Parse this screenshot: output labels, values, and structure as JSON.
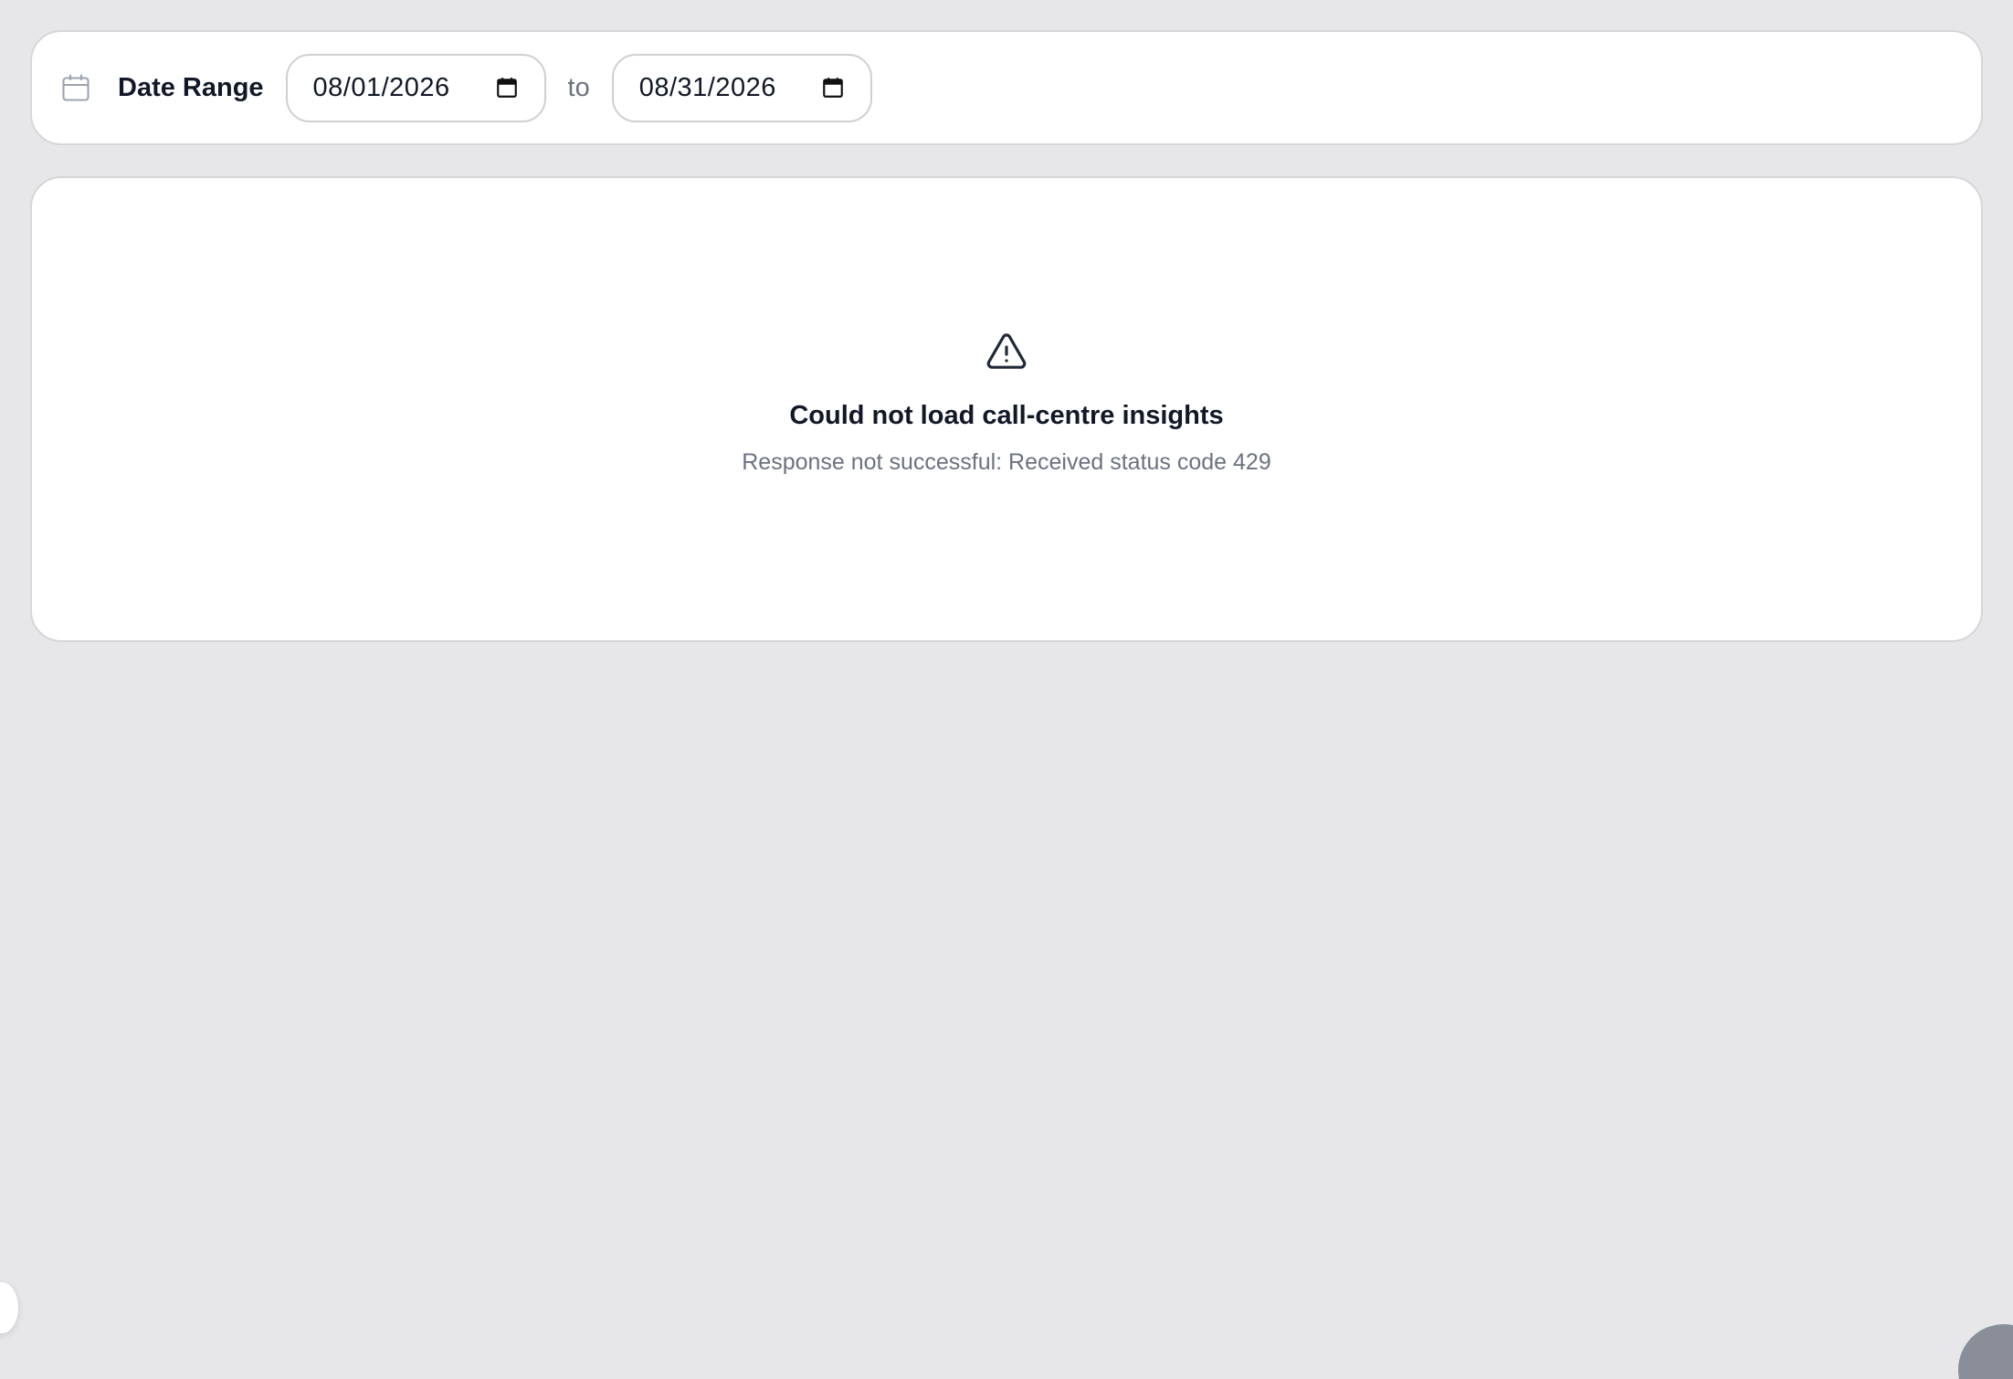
{
  "filter": {
    "icon": "calendar-icon",
    "label": "Date Range",
    "from_date": "08/01/2026",
    "separator": "to",
    "to_date": "08/31/2026",
    "picker_icon": "calendar-picker-icon"
  },
  "error": {
    "icon": "warning-triangle-icon",
    "title": "Could not load call-centre insights",
    "message": "Response not successful: Received status code 429"
  },
  "colors": {
    "background": "#e7e7ea",
    "card": "#ffffff",
    "text_primary": "#111827",
    "text_secondary": "#6b7280",
    "border": "#d6d6da"
  }
}
